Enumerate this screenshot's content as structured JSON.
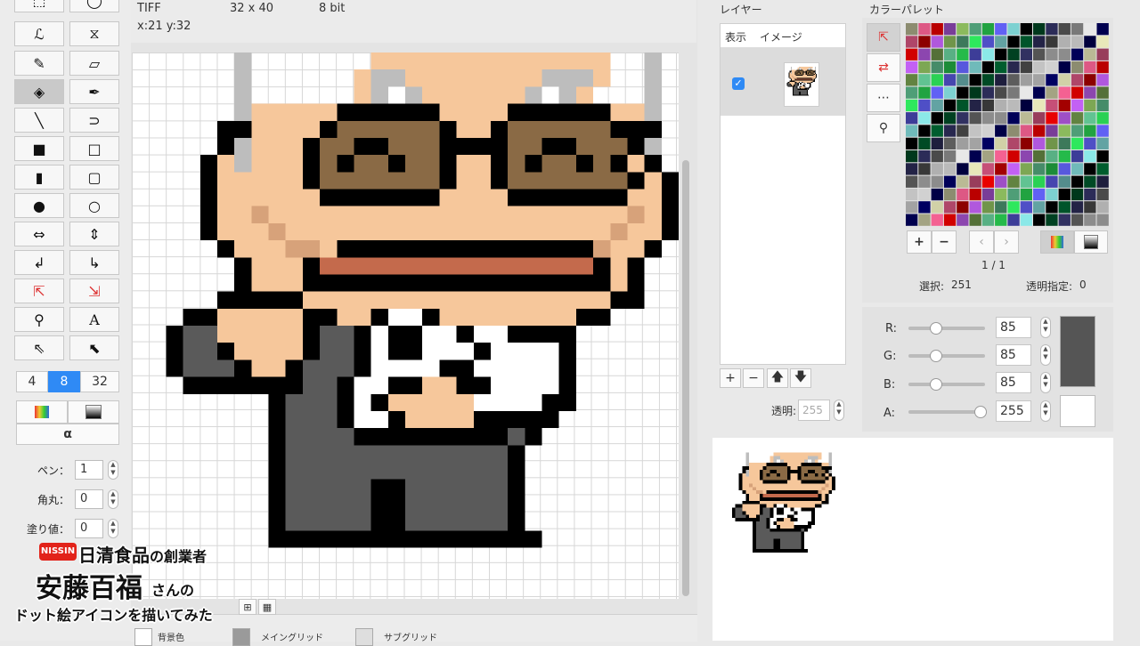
{
  "info_bar": {
    "format": "TIFF",
    "dimensions": "32 x 40",
    "depth": "8 bit",
    "coords": "x:21 y:32"
  },
  "tools": {
    "size_options": [
      "4",
      "8",
      "32"
    ],
    "alpha_label": "α",
    "pen_label": "ペン：",
    "pen_value": "1",
    "round_label": "角丸：",
    "round_value": "0",
    "fill_label": "塗り値：",
    "fill_value": "0"
  },
  "layers": {
    "title": "レイヤー",
    "col_show": "表示",
    "col_image": "イメージ",
    "opacity_label": "透明:",
    "opacity_value": "255"
  },
  "palette": {
    "title": "カラーパレット",
    "page": "1 / 1",
    "selection_label": "選択:",
    "selection_value": "251",
    "transparent_label": "透明指定:",
    "transparent_value": "0"
  },
  "rgba": {
    "r_label": "R:",
    "r_value": "85",
    "g_label": "G:",
    "g_value": "85",
    "b_label": "B:",
    "b_value": "85",
    "a_label": "A:",
    "a_value": "255",
    "current_color": "#555555"
  },
  "bottom": {
    "bg_label": "背景色",
    "main_grid_label": "メイングリッド",
    "sub_grid_label": "サブグリッド"
  },
  "caption": {
    "brand": "NISSIN",
    "line1a": "日清食品",
    "line1b": "の創業者",
    "line2a": "安藤百福",
    "line2b": "さんの",
    "line3": "ドット絵アイコンを描いてみた"
  },
  "colors": {
    "skin": "#f6c79b",
    "skin_shade": "#d7a27a",
    "hair": "#bdbdbd",
    "lens": "#8a6a45",
    "black": "#000000",
    "suit": "#5a5a5a",
    "mouth": "#c46a4c",
    "accent": "#2f8af5"
  }
}
